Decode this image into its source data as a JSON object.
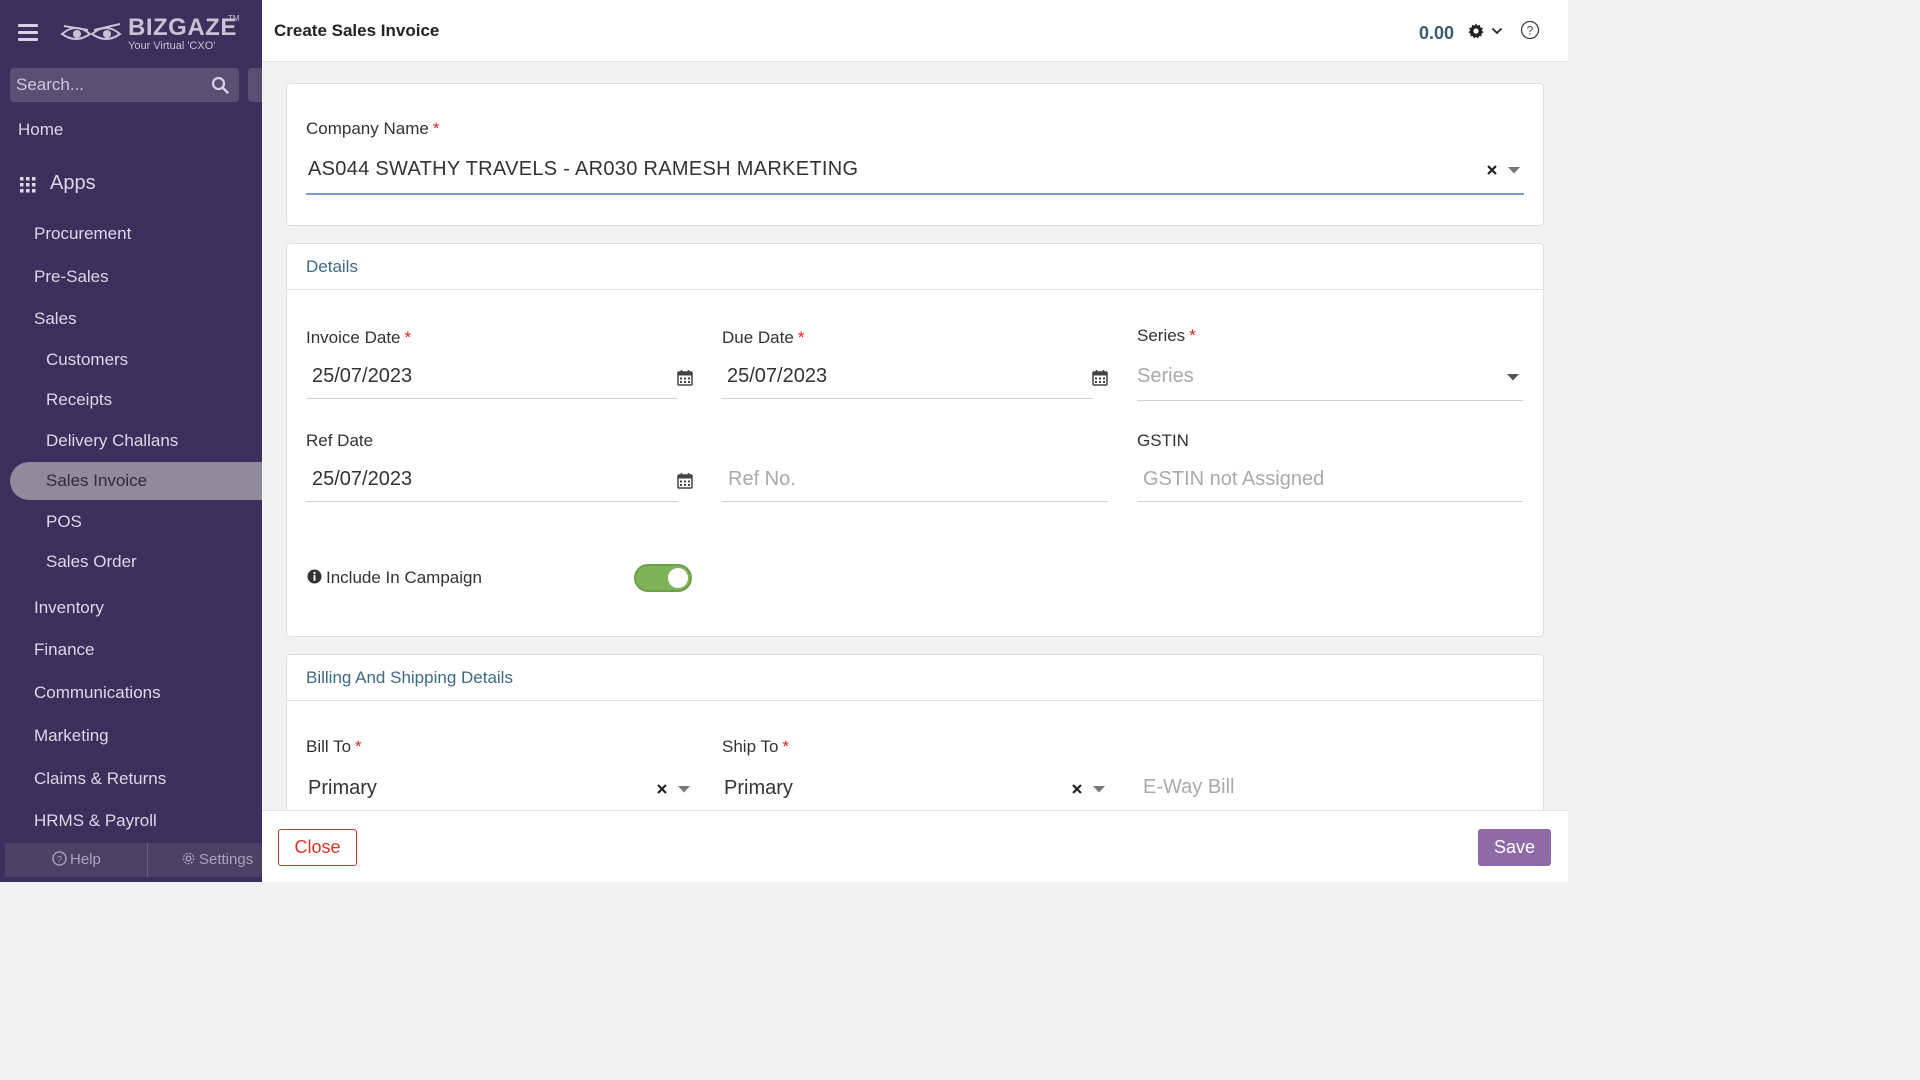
{
  "sidebar": {
    "logo": {
      "word": "BIZGAZE",
      "tm": "TM",
      "tagline": "Your Virtual 'CXO'"
    },
    "search_placeholder": "Search...",
    "home": "Home",
    "apps": "Apps",
    "items": [
      {
        "label": "Procurement"
      },
      {
        "label": "Pre-Sales"
      },
      {
        "label": "Sales"
      },
      {
        "label": "Customers"
      },
      {
        "label": "Receipts"
      },
      {
        "label": "Delivery Challans"
      },
      {
        "label": "Sales Invoice",
        "active": true
      },
      {
        "label": "POS"
      },
      {
        "label": "Sales Order"
      },
      {
        "label": "Inventory"
      },
      {
        "label": "Finance"
      },
      {
        "label": "Communications"
      },
      {
        "label": "Marketing"
      },
      {
        "label": "Claims & Returns"
      },
      {
        "label": "HRMS & Payroll"
      }
    ],
    "help": "Help",
    "settings": "Settings"
  },
  "header": {
    "title": "Create Sales Invoice",
    "amount": "0.00"
  },
  "company": {
    "label": "Company Name",
    "value": "AS044 SWATHY TRAVELS - AR030 RAMESH MARKETING"
  },
  "details": {
    "title": "Details",
    "invoice_date": {
      "label": "Invoice Date",
      "value": "25/07/2023"
    },
    "due_date": {
      "label": "Due Date",
      "value": "25/07/2023"
    },
    "series": {
      "label": "Series",
      "placeholder": "Series"
    },
    "ref_date": {
      "label": "Ref Date",
      "value": "25/07/2023"
    },
    "ref_no": {
      "placeholder": "Ref No."
    },
    "gstin": {
      "label": "GSTIN",
      "placeholder": "GSTIN not Assigned"
    },
    "campaign": {
      "label": "Include In Campaign",
      "enabled": true
    }
  },
  "billing": {
    "title": "Billing And Shipping Details",
    "bill_to": {
      "label": "Bill To",
      "value": "Primary"
    },
    "ship_to": {
      "label": "Ship To",
      "value": "Primary"
    },
    "eway": {
      "placeholder": "E-Way Bill"
    }
  },
  "footer": {
    "close": "Close",
    "save": "Save"
  },
  "colors": {
    "sidebar_bg": "#3d2f5c",
    "accent_purple": "#8e6aa7",
    "danger": "#d9342b",
    "toggle_on": "#7fb35a",
    "section_title": "#3f6a82"
  }
}
